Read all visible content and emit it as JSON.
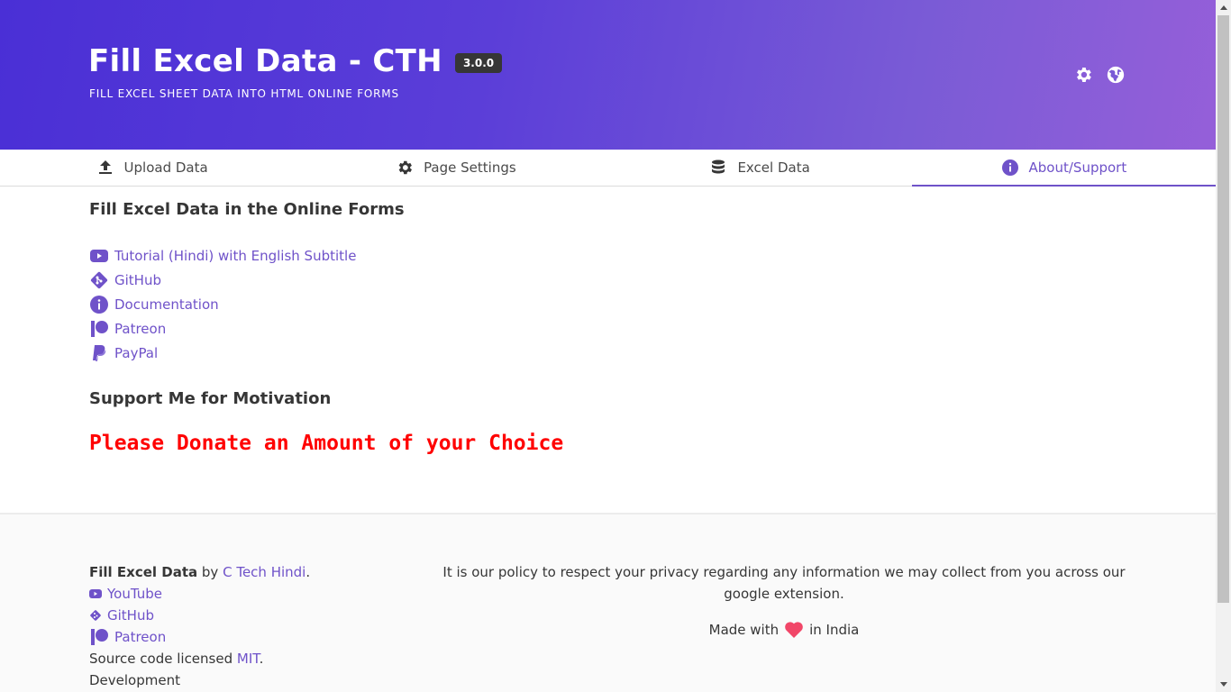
{
  "header": {
    "title": "Fill Excel Data - CTH",
    "version": "3.0.0",
    "subtitle": "FILL EXCEL SHEET DATA INTO HTML ONLINE FORMS",
    "icons": [
      "gear-icon",
      "globe-icon"
    ]
  },
  "tabs": [
    {
      "label": "Upload Data",
      "icon": "upload-icon",
      "active": false
    },
    {
      "label": "Page Settings",
      "icon": "gear-icon",
      "active": false
    },
    {
      "label": "Excel Data",
      "icon": "database-icon",
      "active": false
    },
    {
      "label": "About/Support",
      "icon": "info-icon",
      "active": true
    }
  ],
  "main": {
    "heading": "Fill Excel Data in the Online Forms",
    "links": [
      {
        "label": "Tutorial (Hindi) with English Subtitle",
        "icon": "youtube-icon"
      },
      {
        "label": "GitHub",
        "icon": "git-icon"
      },
      {
        "label": "Documentation",
        "icon": "info-icon"
      },
      {
        "label": "Patreon",
        "icon": "patreon-icon"
      },
      {
        "label": "PayPal",
        "icon": "paypal-icon"
      }
    ],
    "support_heading": "Support Me for Motivation",
    "donate_text": "Please Donate an Amount of your Choice"
  },
  "footer": {
    "app_name": "Fill Excel Data",
    "by_text": "by",
    "author": "C Tech Hindi",
    "period": ".",
    "links": [
      {
        "label": "YouTube",
        "icon": "youtube-icon"
      },
      {
        "label": "GitHub",
        "icon": "git-icon"
      },
      {
        "label": "Patreon",
        "icon": "patreon-icon"
      }
    ],
    "license_prefix": "Source code licensed",
    "license": "MIT",
    "license_suffix": ".",
    "development": "Development",
    "privacy": "It is our policy to respect your privacy regarding any information we may collect from you across our google extension.",
    "made_with": "Made with",
    "made_in": "in India"
  },
  "colors": {
    "accent": "#6f52c9",
    "hero_start": "#4a2fd6",
    "hero_end": "#955fd9",
    "donate": "#ff0000",
    "heart": "#f14668"
  }
}
